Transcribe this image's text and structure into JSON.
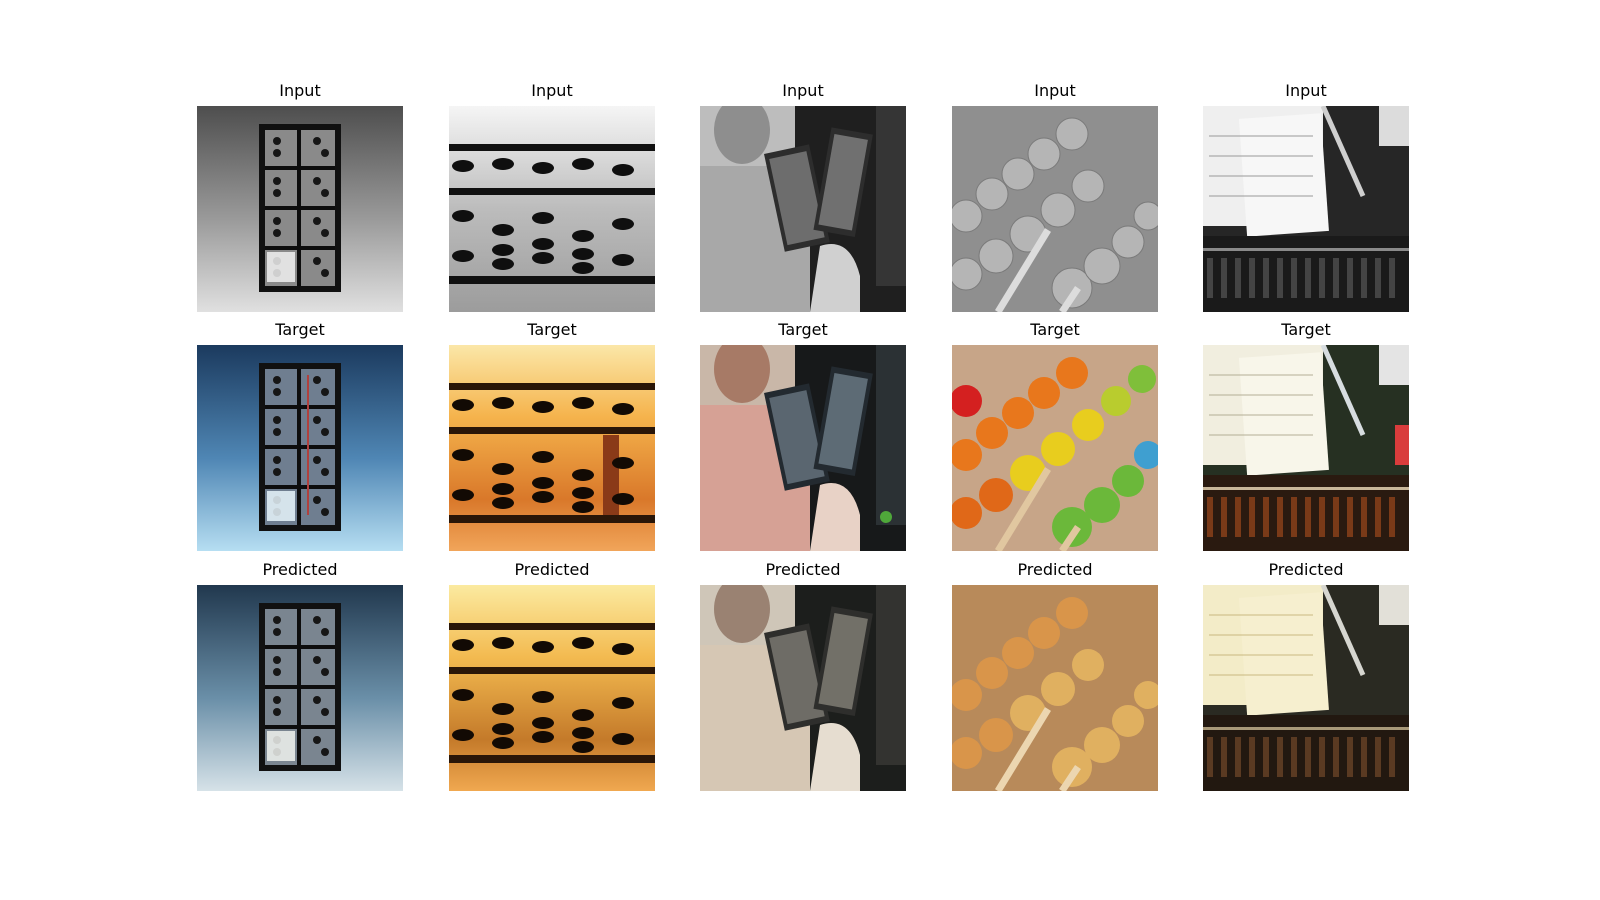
{
  "figure": {
    "rows": [
      {
        "label": "Input",
        "cells": [
          {
            "title": "Input",
            "picture": "grayscale-upright-abacus"
          },
          {
            "title": "Input",
            "picture": "grayscale-abacus-closeup"
          },
          {
            "title": "Input",
            "picture": "grayscale-man-holding-abacus"
          },
          {
            "title": "Input",
            "picture": "grayscale-abacus-beads-macro"
          },
          {
            "title": "Input",
            "picture": "grayscale-desk-papers-pen-abacus"
          }
        ]
      },
      {
        "label": "Target",
        "cells": [
          {
            "title": "Target",
            "picture": "color-upright-abacus-blue-background"
          },
          {
            "title": "Target",
            "picture": "color-abacus-closeup-amber"
          },
          {
            "title": "Target",
            "picture": "color-man-pink-shirt-holding-abacus"
          },
          {
            "title": "Target",
            "picture": "color-rainbow-abacus-beads"
          },
          {
            "title": "Target",
            "picture": "color-desk-papers-pen-wooden-abacus"
          }
        ]
      },
      {
        "label": "Predicted",
        "cells": [
          {
            "title": "Predicted",
            "picture": "predicted-upright-abacus-blue"
          },
          {
            "title": "Predicted",
            "picture": "predicted-abacus-closeup-amber"
          },
          {
            "title": "Predicted",
            "picture": "predicted-man-holding-abacus-muted"
          },
          {
            "title": "Predicted",
            "picture": "predicted-abacus-beads-orange"
          },
          {
            "title": "Predicted",
            "picture": "predicted-desk-papers-yellowish"
          }
        ]
      }
    ]
  },
  "palettes": {
    "gray_bg_top": "#5a5a5a",
    "gray_bg_bottom": "#d8d8d8",
    "blue_bg_top": "#1e3f63",
    "blue_bg_bottom": "#a8d2ea",
    "amber_light": "#f7c45a",
    "amber_dark": "#8a4a14",
    "pink_shirt": "#d9a497",
    "bead_red": "#d42020",
    "bead_orange": "#e8771c",
    "bead_yellow": "#e8cd1e",
    "bead_green": "#6bb83a",
    "bead_pred_orange": "#d99a4a",
    "paper_white": "#f2f0e6",
    "paper_yellow": "#f4e9b8",
    "wood_brown": "#7a3a18",
    "desk_dark": "#262820"
  }
}
